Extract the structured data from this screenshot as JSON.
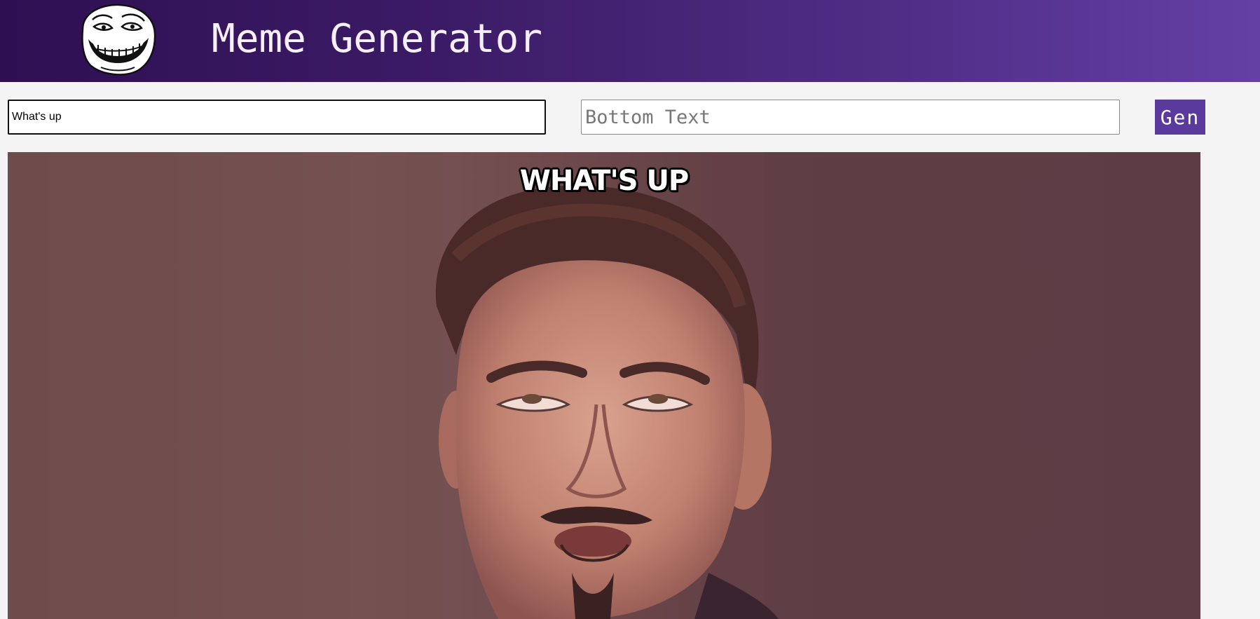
{
  "header": {
    "title": "Meme Generator",
    "logo_icon": "troll-face-icon"
  },
  "form": {
    "top_text_value": "What's up",
    "bottom_text_value": "",
    "bottom_text_placeholder": "Bottom Text",
    "generate_label": "Gen"
  },
  "meme": {
    "top_text": "What's up",
    "bottom_text": "",
    "image_subject": "man-rolling-eyes-photo"
  },
  "colors": {
    "header_gradient_start": "#2e0f52",
    "header_gradient_end": "#6440a5",
    "button": "#5a3a9c",
    "page_background": "#f4f4f4"
  }
}
